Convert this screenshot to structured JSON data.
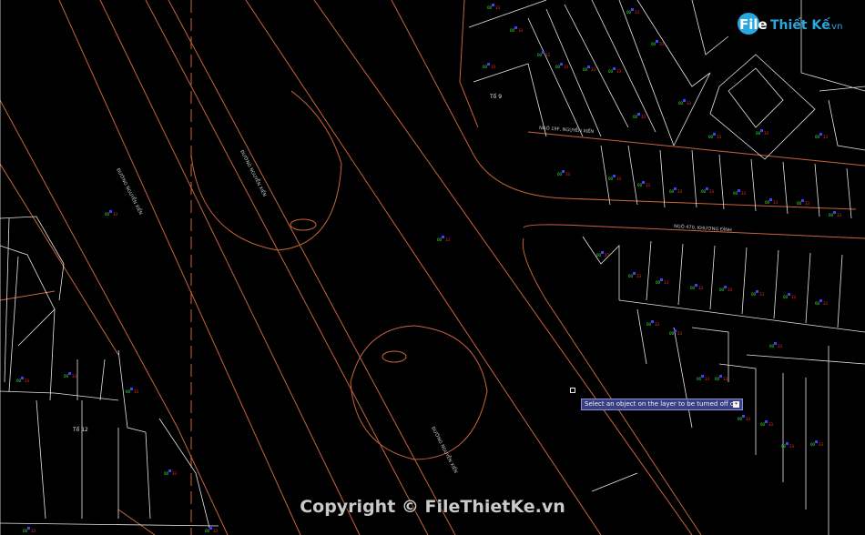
{
  "prompt": {
    "text": "Select an object on the layer to be turned off or",
    "key_glyph": "▾"
  },
  "watermark": {
    "brand_part1": "File",
    "brand_part2": "Thiết Kế",
    "brand_part3": ".vn",
    "copyright": "Copyright © FileThietKe.vn"
  },
  "labels": {
    "road_nguyen_xien_top": "NGÕ 19F, NGUYỄN XIỂN",
    "road_khuong_dinh": "NGÕ 470, KHƯƠNG ĐÌNH",
    "road_nguyen_xien_1": "ĐƯỜNG NGUYỄN XIỂN",
    "road_nguyen_xien_2": "ĐƯỜNG NGUYỄN XIỂN",
    "road_nguyen_xien_3": "ĐƯỜNG NGUYỄN XIỂN",
    "block_9": "Tổ 9",
    "block_12": "Tổ 12"
  },
  "colors": {
    "background": "#000000",
    "road_line": "#c8643a",
    "parcel_line": "#e6e6e6",
    "marker_green": "#33ff33",
    "marker_red": "#ff2a2a",
    "marker_blue": "#4040ff",
    "prompt_bg": "#3a3f86"
  }
}
